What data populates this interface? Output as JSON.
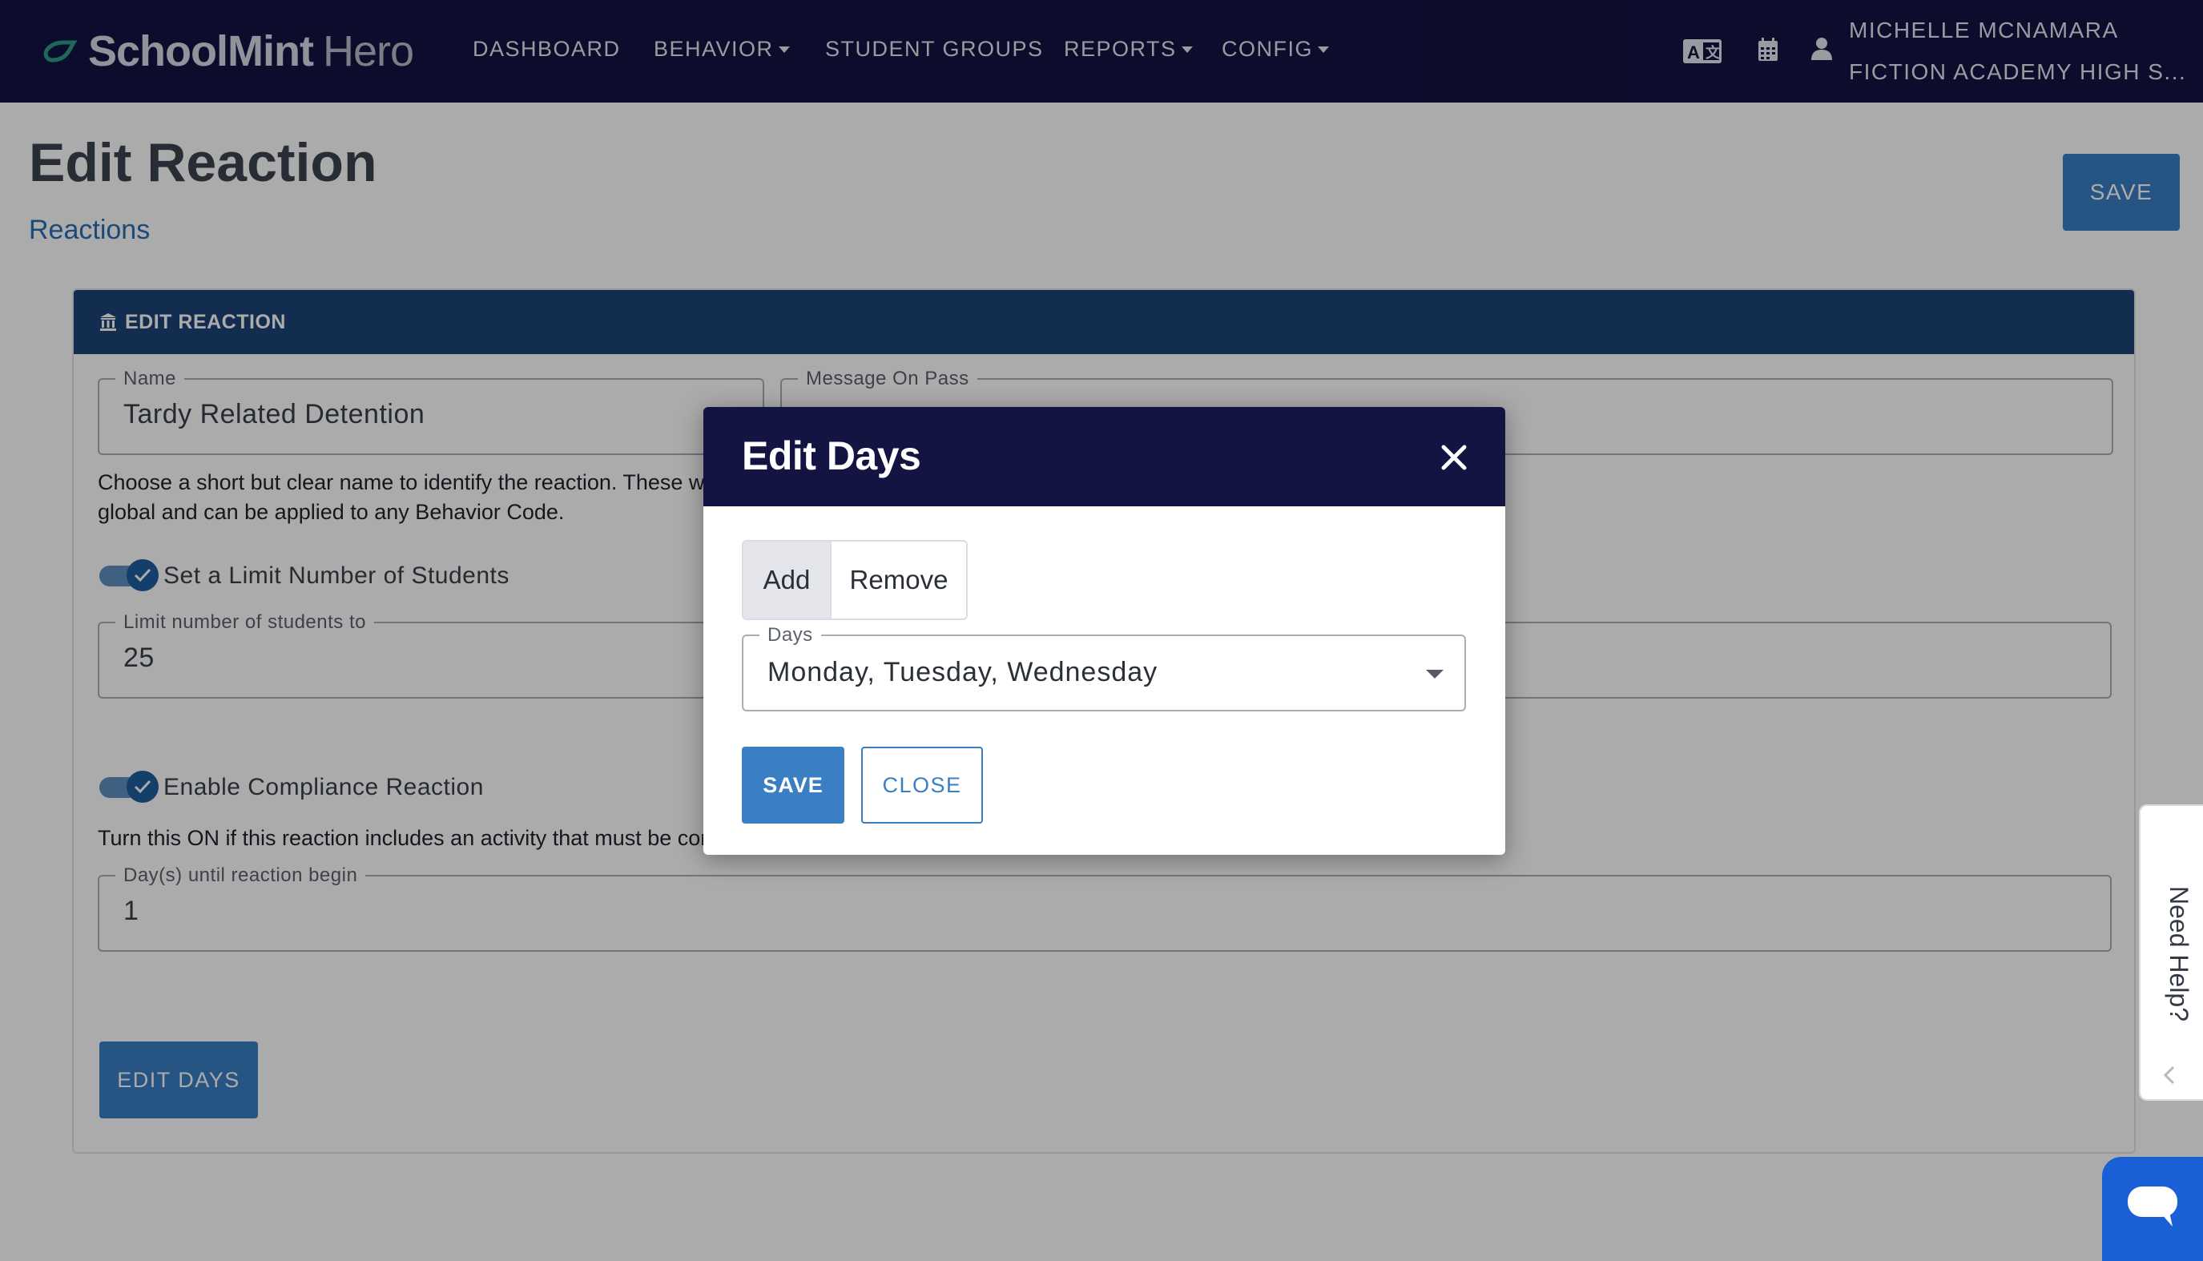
{
  "app": {
    "logo_bold": "SchoolMint",
    "logo_light": "Hero"
  },
  "nav": {
    "dashboard": "DASHBOARD",
    "behavior": "BEHAVIOR",
    "student_groups": "STUDENT GROUPS",
    "reports": "REPORTS",
    "config": "CONFIG"
  },
  "user": {
    "name": "MICHELLE MCNAMARA",
    "school": "FICTION ACADEMY HIGH S..."
  },
  "page": {
    "title": "Edit Reaction",
    "breadcrumb": "Reactions",
    "save_label": "SAVE"
  },
  "card": {
    "header": "EDIT REACTION",
    "name_label": "Name",
    "name_value": "Tardy Related Detention",
    "name_help_1": "Choose a short but clear name to identify the reaction. These will",
    "name_help_2": "global and can be applied to any Behavior Code.",
    "message_label": "Message On Pass",
    "limit_toggle_label": "Set a Limit Number of Students",
    "limit_label": "Limit number of students to",
    "limit_value": "25",
    "compliance_toggle_label": "Enable Compliance Reaction",
    "compliance_help": "Turn this ON if this reaction includes an activity that must be com",
    "days_until_label": "Day(s) until reaction begin",
    "days_until_value": "1",
    "edit_days_label": "EDIT DAYS"
  },
  "modal": {
    "title": "Edit Days",
    "seg_add": "Add",
    "seg_remove": "Remove",
    "days_label": "Days",
    "days_value": "Monday, Tuesday, Wednesday",
    "save_label": "SAVE",
    "close_label": "CLOSE"
  },
  "help_tab": {
    "label": "Need Help?"
  },
  "colors": {
    "navbar": "#131442",
    "card_header": "#1c4477",
    "primary_button": "#3a7fc4",
    "link": "#2a6fb3",
    "chat_button": "#1a5fd6"
  }
}
